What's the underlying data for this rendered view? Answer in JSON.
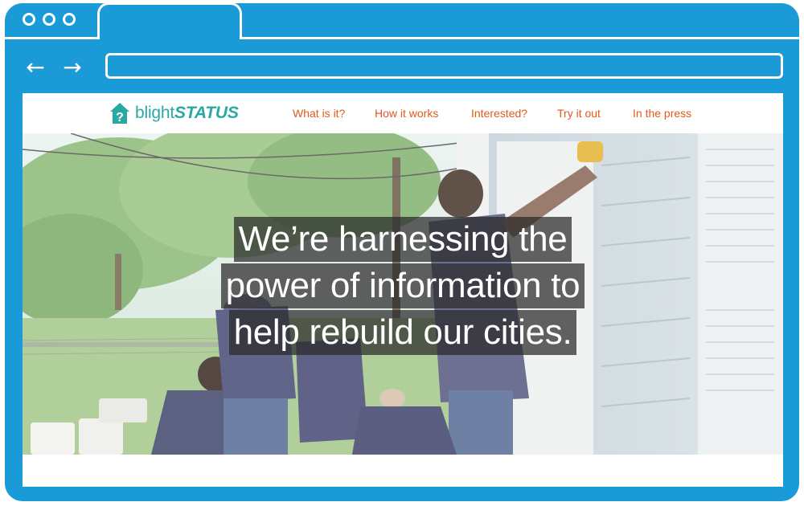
{
  "browser": {
    "back_icon": "arrow-left-icon",
    "forward_icon": "arrow-right-icon",
    "url": ""
  },
  "site": {
    "logo": {
      "icon": "house-question-icon",
      "text_light": "blight",
      "text_bold": "STATUS"
    },
    "nav": [
      {
        "label": "What is it?"
      },
      {
        "label": "How it works"
      },
      {
        "label": "Interested?"
      },
      {
        "label": "Try it out"
      },
      {
        "label": "In the press"
      }
    ],
    "hero": {
      "headline_lines": [
        "We’re harnessing the",
        "power of information to",
        "help rebuild our cities."
      ]
    }
  },
  "colors": {
    "browser_chrome": "#1a9ad6",
    "nav_link": "#e1591c",
    "logo": "#2aa9a3",
    "headline_bg": "#333333"
  }
}
